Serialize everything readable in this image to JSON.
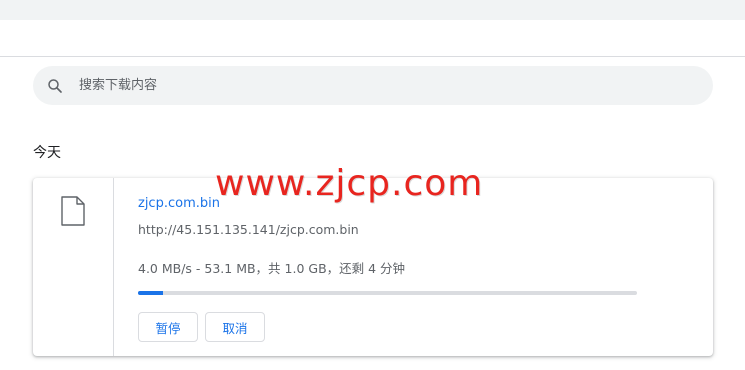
{
  "search": {
    "placeholder": "搜索下载内容"
  },
  "section": {
    "title": "今天"
  },
  "download": {
    "file_name": "zjcp.com.bin",
    "url": "http://45.151.135.141/zjcp.com.bin",
    "status": "4.0 MB/s - 53.1 MB，共 1.0 GB，还剩 4 分钟",
    "progress_fraction": 0.05,
    "pause_label": "暂停",
    "cancel_label": "取消"
  },
  "watermark": {
    "text": "www.zjcp.com"
  },
  "colors": {
    "accent": "#1a73e8",
    "watermark": "#e8251f"
  },
  "icons": {
    "search": "search-icon",
    "file": "file-icon"
  }
}
